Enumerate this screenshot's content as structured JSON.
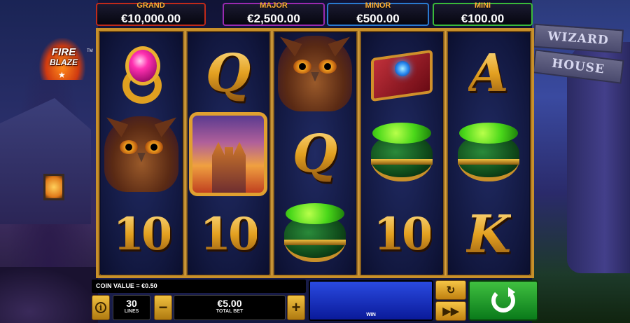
{
  "logo": {
    "line1": "FIRE",
    "line2": "BLAZE",
    "star": "★",
    "tm": "TM"
  },
  "sign": {
    "line1": "WIZARD",
    "line2": "HOUSE"
  },
  "jackpots": {
    "grand": {
      "label": "GRAND",
      "value": "€10,000.00"
    },
    "major": {
      "label": "MAJOR",
      "value": "€2,500.00"
    },
    "minor": {
      "label": "MINOR",
      "value": "€500.00"
    },
    "mini": {
      "label": "MINI",
      "value": "€100.00"
    }
  },
  "reels": [
    [
      "ring",
      "owl",
      "10"
    ],
    [
      "Q",
      "castle",
      "10"
    ],
    [
      "owl",
      "Q",
      "cauldron"
    ],
    [
      "book",
      "cauldron",
      "10"
    ],
    [
      "A",
      "cauldron",
      "K"
    ]
  ],
  "symbols": {
    "ten": "10",
    "queen": "Q",
    "ace": "A",
    "king": "K"
  },
  "controls": {
    "coin_value": "COIN VALUE = €0.50",
    "info_icon": "i",
    "lines_value": "30",
    "lines_label": "LINES",
    "bet_minus": "−",
    "bet_plus": "+",
    "total_bet_value": "€5.00",
    "total_bet_label": "TOTAL BET",
    "win_label": "WIN",
    "auto_icon": "↻",
    "turbo_icon": "▶▶"
  },
  "colors": {
    "gold": "#e0a030",
    "spin_green": "#2aa02a",
    "win_blue": "#1a3ad0"
  }
}
